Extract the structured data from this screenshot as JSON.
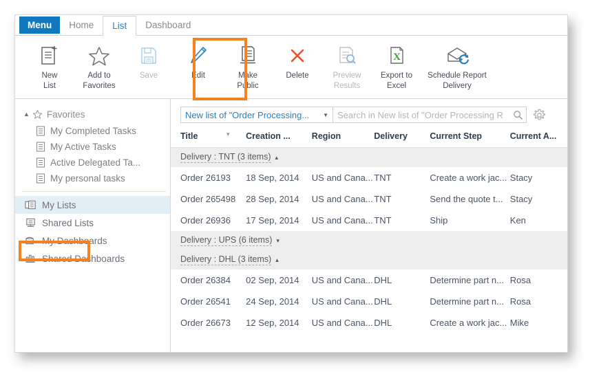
{
  "tabs": [
    {
      "label": "Menu",
      "kind": "menu"
    },
    {
      "label": "Home",
      "kind": "normal"
    },
    {
      "label": "List",
      "kind": "active"
    },
    {
      "label": "Dashboard",
      "kind": "normal"
    }
  ],
  "ribbon": {
    "buttons": [
      {
        "label": "New\nList",
        "line1": "New",
        "line2": "List",
        "icon": "new-list-icon",
        "disabled": false
      },
      {
        "label": "Add to Favorites",
        "line1": "Add to",
        "line2": "Favorites",
        "icon": "star-icon",
        "disabled": false
      },
      {
        "label": "Save",
        "line1": "Save",
        "line2": "",
        "icon": "save-icon",
        "disabled": true
      },
      {
        "label": "Edit",
        "line1": "Edit",
        "line2": "",
        "icon": "pencil-icon",
        "disabled": false
      },
      {
        "label": "Make Public",
        "line1": "Make",
        "line2": "Public",
        "icon": "make-public-icon",
        "disabled": false
      },
      {
        "label": "Delete",
        "line1": "Delete",
        "line2": "",
        "icon": "close-x-icon",
        "disabled": false
      },
      {
        "label": "Preview Results",
        "line1": "Preview",
        "line2": "Results",
        "icon": "preview-icon",
        "disabled": true
      },
      {
        "label": "Export to Excel",
        "line1": "Export to",
        "line2": "Excel",
        "icon": "excel-icon",
        "disabled": false
      },
      {
        "label": "Schedule Report Delivery",
        "line1": "Schedule Report",
        "line2": "Delivery",
        "icon": "schedule-mail-icon",
        "disabled": false
      }
    ]
  },
  "sidebar": {
    "favorites_header": "Favorites",
    "favorites": [
      {
        "label": "My Completed Tasks"
      },
      {
        "label": "My Active Tasks"
      },
      {
        "label": "Active Delegated Ta..."
      },
      {
        "label": "My personal tasks"
      }
    ],
    "groups": [
      {
        "label": "My Lists",
        "icon": "lists-icon",
        "selected": true
      },
      {
        "label": "Shared Lists",
        "icon": "shared-list-icon",
        "selected": false
      },
      {
        "label": "My Dashboards",
        "icon": "dashboard-icon",
        "selected": false
      },
      {
        "label": "Shared Dashboards",
        "icon": "shared-dashboard-icon",
        "selected": false
      }
    ]
  },
  "list_toolbar": {
    "list_selector_value": "New list of \"Order Processing...",
    "search_placeholder": "Search in New list of \"Order Processing R"
  },
  "table": {
    "columns": [
      {
        "key": "title",
        "label": "Title",
        "sorted": true
      },
      {
        "key": "creation",
        "label": "Creation ..."
      },
      {
        "key": "region",
        "label": "Region"
      },
      {
        "key": "delivery",
        "label": "Delivery"
      },
      {
        "key": "step",
        "label": "Current Step"
      },
      {
        "key": "assignee",
        "label": "Current A..."
      }
    ],
    "groups": [
      {
        "label": "Delivery : TNT (3 items)",
        "expanded": true,
        "caret": "▴",
        "rows": [
          {
            "title": "Order 26193",
            "creation": "18 Sep, 2014",
            "region": "US and Cana...",
            "delivery": "TNT",
            "step": "Create a work jac...",
            "assignee": "Stacy"
          },
          {
            "title": "Order 265498",
            "creation": "28 Sep, 2014",
            "region": "US and Cana...",
            "delivery": "TNT",
            "step": "Send the quote t...",
            "assignee": "Stacy"
          },
          {
            "title": "Order 26936",
            "creation": "17 Sep, 2014",
            "region": "US and Cana...",
            "delivery": "TNT",
            "step": "Ship",
            "assignee": "Ken"
          }
        ]
      },
      {
        "label": "Delivery : UPS (6 items)",
        "expanded": false,
        "caret": "▾",
        "rows": []
      },
      {
        "label": "Delivery : DHL (3 items)",
        "expanded": true,
        "caret": "▴",
        "rows": [
          {
            "title": "Order 26384",
            "creation": "02 Sep, 2014",
            "region": "US and Cana...",
            "delivery": "DHL",
            "step": "Determine part n...",
            "assignee": "Rosa"
          },
          {
            "title": "Order 26541",
            "creation": "24 Sep, 2014",
            "region": "US and Cana...",
            "delivery": "DHL",
            "step": "Determine part n...",
            "assignee": "Rosa"
          },
          {
            "title": "Order 26673",
            "creation": "12 Sep, 2014",
            "region": "US and Cana...",
            "delivery": "DHL",
            "step": "Create a work jac...",
            "assignee": "Mike"
          }
        ]
      }
    ]
  },
  "colors": {
    "accent_blue": "#1278bd",
    "highlight_orange": "#f5821f",
    "selected_row": "#e3eff7",
    "group_header": "#eeeeee",
    "delete_red": "#e8502a",
    "excel_green": "#3f9c35"
  }
}
